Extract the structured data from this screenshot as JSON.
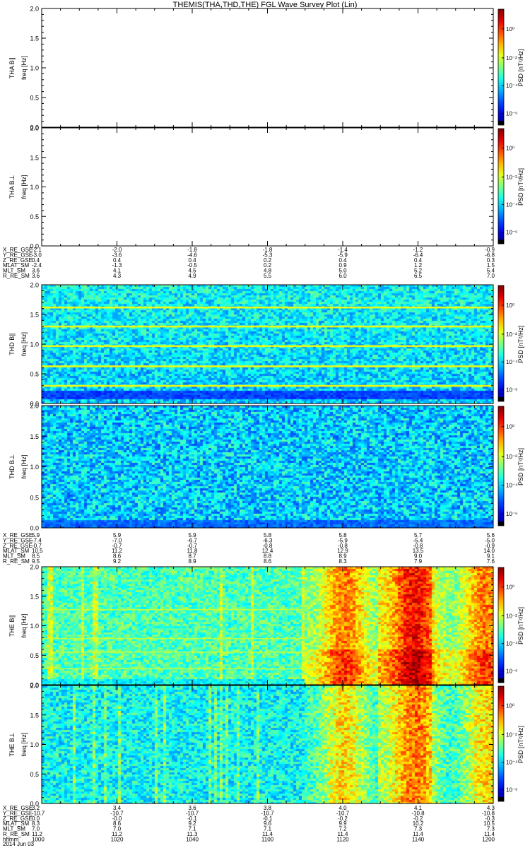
{
  "title": "THEMIS(THA,THD,THE) FGL Wave Survey Plot (Lin)",
  "colorbar_label": "PSD [nT²/Hz]",
  "colorbar_ticks": [
    "10⁰",
    "10⁻²",
    "10⁻⁴",
    "10⁻⁶"
  ],
  "freq_ticks": [
    "0.0",
    "0.5",
    "1.0",
    "1.5",
    "2.0"
  ],
  "date": "2014 Jun 03",
  "chart_data": [
    {
      "type": "heatmap",
      "panel": "THA B_par",
      "ylabel_probe": "THA B∥",
      "ylabel_unit": "freq [Hz]",
      "ylim": [
        0,
        2
      ],
      "status": "no data"
    },
    {
      "type": "heatmap",
      "panel": "THA B_perp",
      "ylabel_probe": "THA B⊥",
      "ylabel_unit": "freq [Hz]",
      "ylim": [
        0,
        2
      ],
      "status": "no data"
    },
    {
      "type": "heatmap",
      "panel": "THD B_par",
      "ylabel_probe": "THD B∥",
      "ylabel_unit": "freq [Hz]",
      "ylim": [
        0,
        2
      ],
      "lines_hz": [
        0.3,
        0.63,
        0.97,
        1.3,
        1.62
      ],
      "level": "low"
    },
    {
      "type": "heatmap",
      "panel": "THD B_perp",
      "ylabel_probe": "THD B⊥",
      "ylabel_unit": "freq [Hz]",
      "ylim": [
        0,
        2
      ],
      "level": "low"
    },
    {
      "type": "heatmap",
      "panel": "THE B_par",
      "ylabel_probe": "THE B∥",
      "ylabel_unit": "freq [Hz]",
      "ylim": [
        0,
        2
      ],
      "level": "rising after 11:10"
    },
    {
      "type": "heatmap",
      "panel": "THE B_perp",
      "ylabel_probe": "THE B⊥",
      "ylabel_unit": "freq [Hz]",
      "ylim": [
        0,
        2
      ],
      "level": "rising after 11:10"
    }
  ],
  "ephemeris": [
    {
      "labels": [
        "X_RE_GSE",
        "Y_RE_GSE",
        "Z_RE_GSE",
        "MLAT_SM",
        "MLT_SM",
        "R_RE_SM"
      ],
      "columns": [
        [
          "-2.1",
          "-3.0",
          "0.4",
          "-2.4",
          "3.6",
          "3.6"
        ],
        [
          "-2.0",
          "-3.6",
          "0.4",
          "-1.3",
          "4.1",
          "4.3"
        ],
        [
          "-1.8",
          "-4.6",
          "0.4",
          "-0.5",
          "4.5",
          "4.9"
        ],
        [
          "-1.8",
          "-5.3",
          "0.2",
          "0.2",
          "4.8",
          "5.5"
        ],
        [
          "-1.4",
          "-5.9",
          "0.4",
          "0.9",
          "5.0",
          "6.0"
        ],
        [
          "-1.2",
          "-6.4",
          "0.4",
          "1.2",
          "5.2",
          "6.5"
        ],
        [
          "-0.9",
          "-6.8",
          "0.3",
          "1.5",
          "5.4",
          "7.0"
        ]
      ]
    },
    {
      "labels": [
        "X_RE_GSE",
        "Y_RE_GSE",
        "Z_RE_GSE",
        "MLAT_SM",
        "MLT_SM",
        "R_RE_SM"
      ],
      "columns": [
        [
          "5.9",
          "-7.4",
          "-0.7",
          "10.5",
          "8.5",
          "9.5"
        ],
        [
          "5.9",
          "-7.0",
          "-0.7",
          "11.2",
          "8.6",
          "9.2"
        ],
        [
          "5.9",
          "-6.7",
          "-0.7",
          "11.8",
          "8.7",
          "8.9"
        ],
        [
          "5.8",
          "-6.3",
          "-0.8",
          "12.4",
          "8.8",
          "8.6"
        ],
        [
          "5.8",
          "-5.9",
          "-0.8",
          "12.9",
          "8.9",
          "8.3"
        ],
        [
          "5.7",
          "-5.4",
          "-0.8",
          "13.5",
          "9.0",
          "7.9"
        ],
        [
          "5.6",
          "-5.0",
          "-0.9",
          "14.0",
          "9.1",
          "7.6"
        ]
      ]
    },
    {
      "labels": [
        "X_RE_GSE",
        "Y_RE_GSE",
        "Z_RE_GSE",
        "MLAT_SM",
        "MLT_SM",
        "R_RE_SM",
        "hhmm"
      ],
      "columns": [
        [
          "3.2",
          "-10.7",
          "0.0",
          "8.3",
          "7.0",
          "11.2",
          "1000"
        ],
        [
          "3.4",
          "-10.7",
          "-0.0",
          "8.6",
          "7.0",
          "11.2",
          "1020"
        ],
        [
          "3.6",
          "-10.7",
          "-0.1",
          "9.2",
          "7.1",
          "11.3",
          "1040"
        ],
        [
          "3.8",
          "-10.7",
          "-0.1",
          "9.6",
          "7.1",
          "11.4",
          "1100"
        ],
        [
          "4.0",
          "-10.7",
          "-0.2",
          "9.9",
          "7.2",
          "11.4",
          "1120"
        ],
        [
          "4.1",
          "-10.8",
          "-0.2",
          "10.2",
          "7.3",
          "11.4",
          "1140"
        ],
        [
          "4.3",
          "-10.8",
          "-0.3",
          "10.5",
          "7.3",
          "11.4",
          "1200"
        ]
      ]
    }
  ]
}
